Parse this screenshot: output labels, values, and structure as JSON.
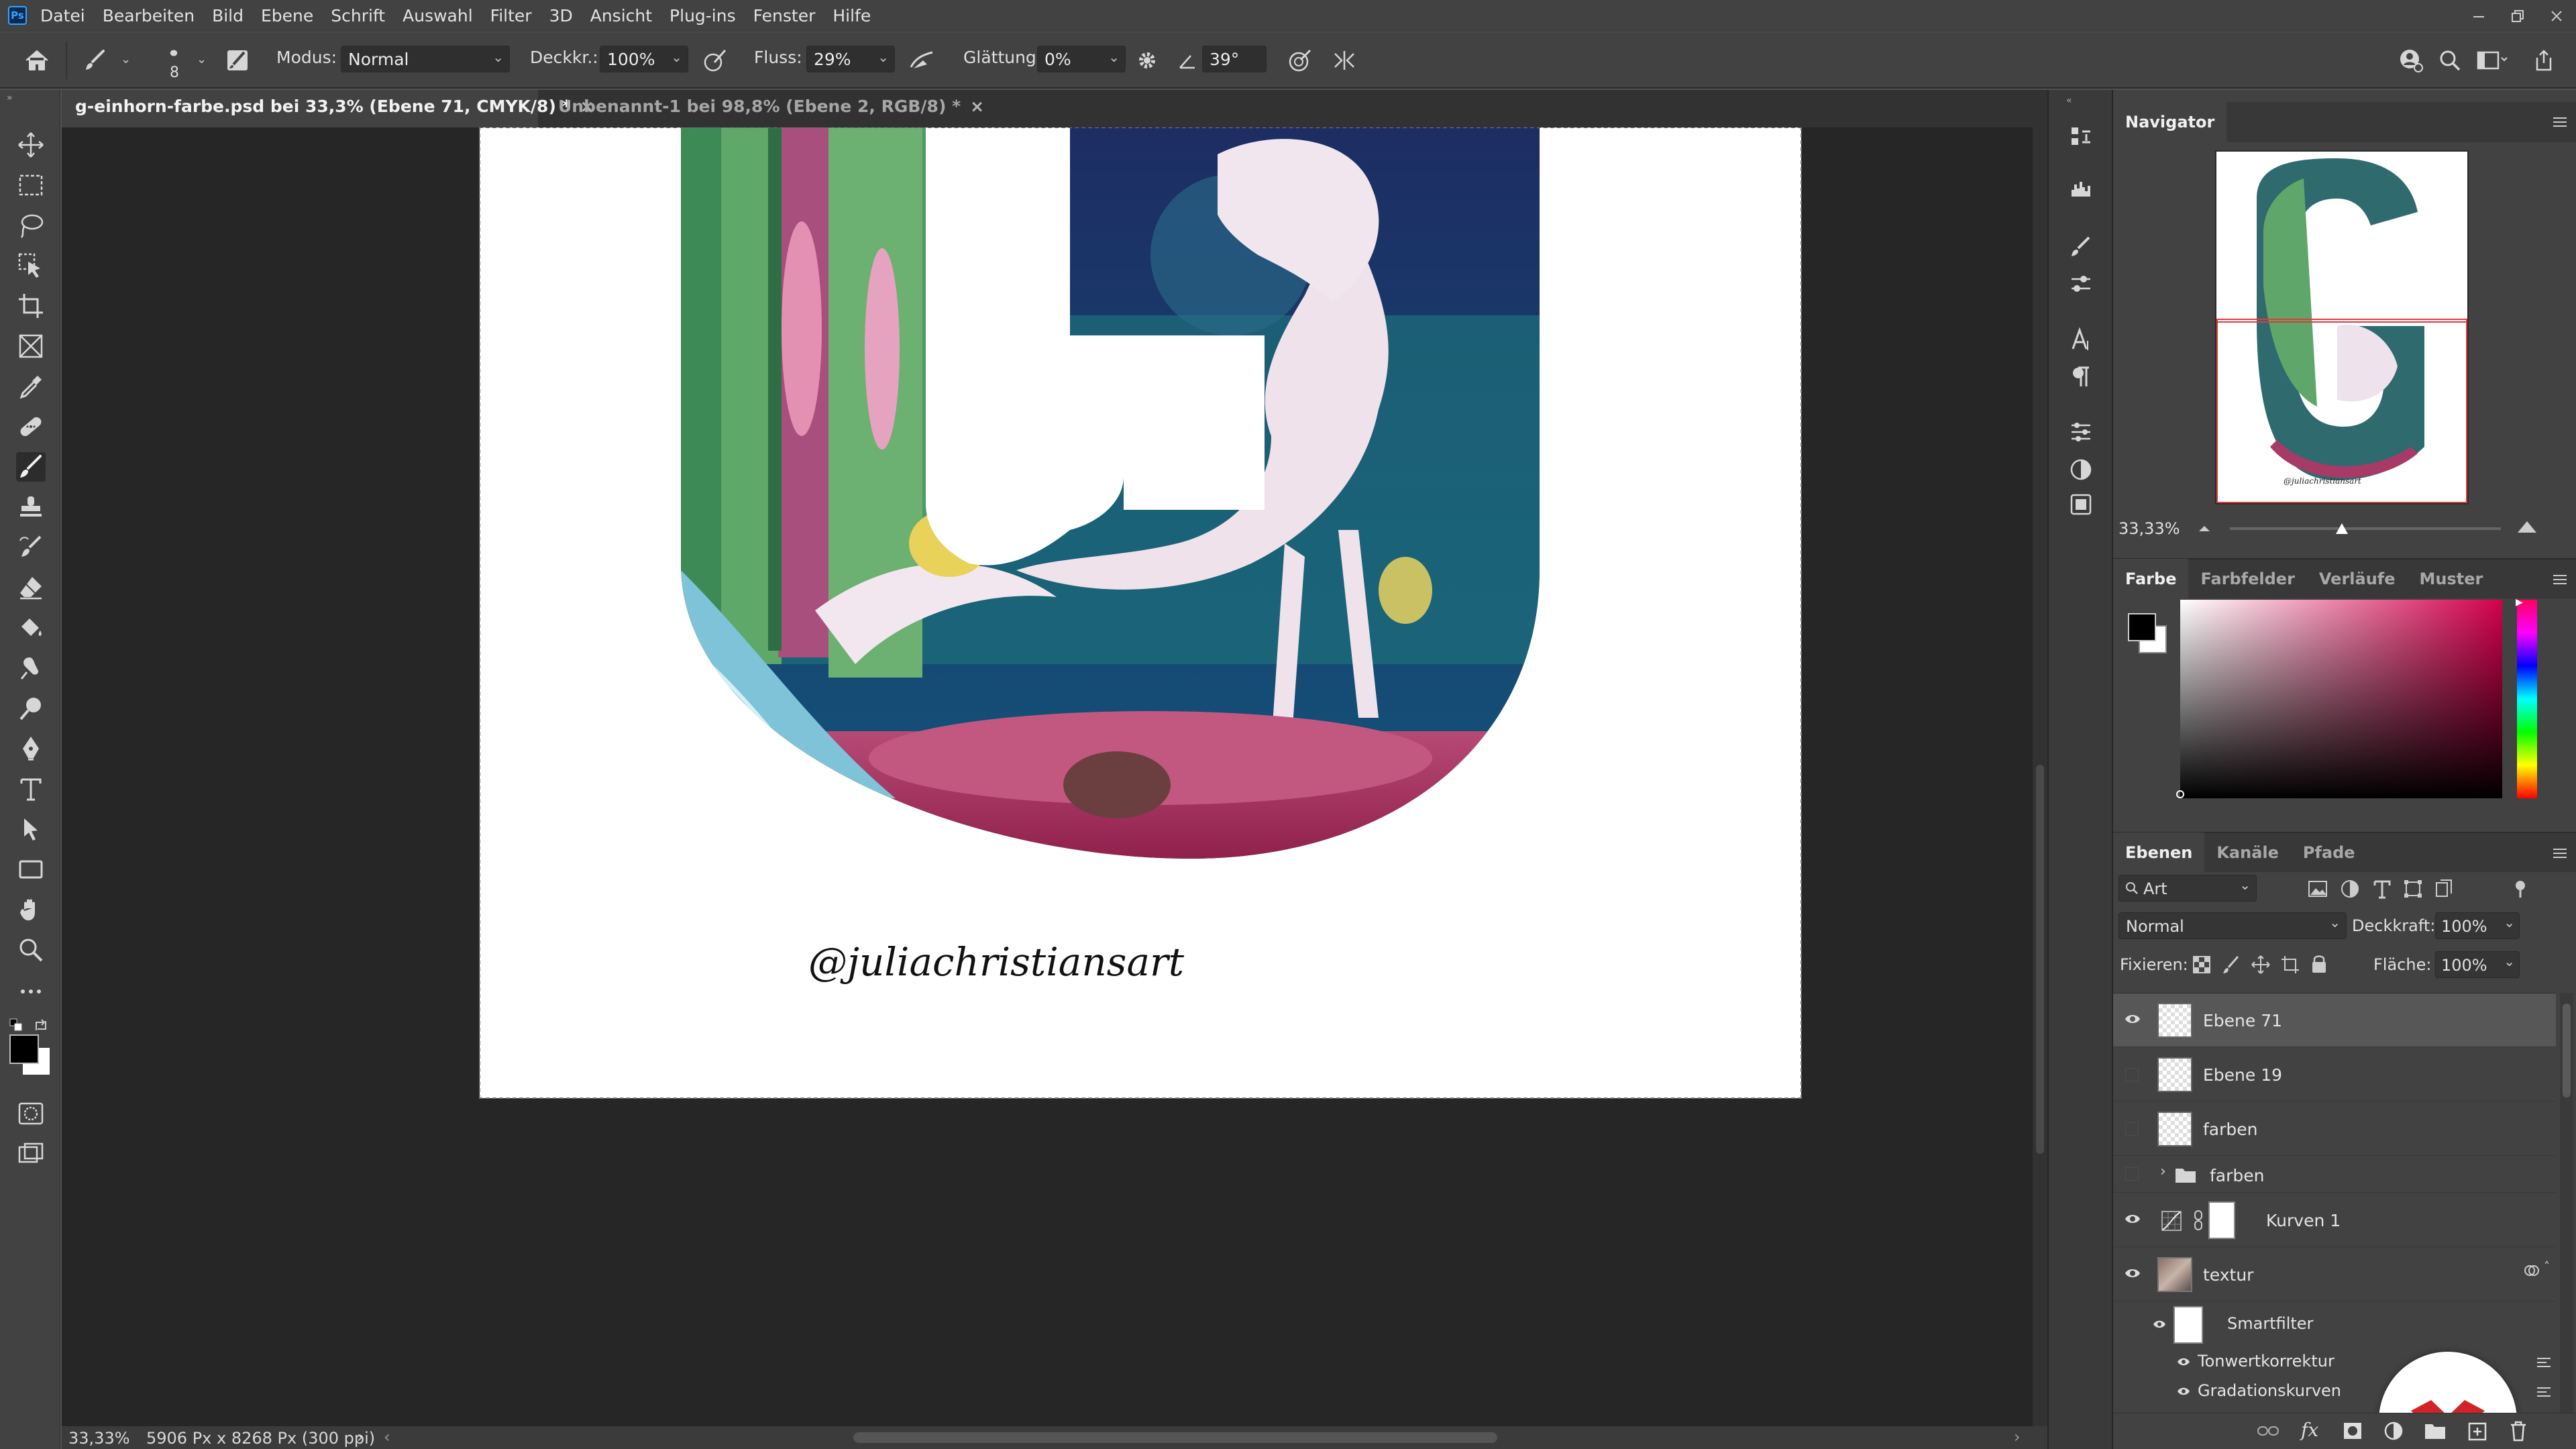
{
  "menubar": {
    "logo": "Ps",
    "items": [
      "Datei",
      "Bearbeiten",
      "Bild",
      "Ebene",
      "Schrift",
      "Auswahl",
      "Filter",
      "3D",
      "Ansicht",
      "Plug-ins",
      "Fenster",
      "Hilfe"
    ]
  },
  "options": {
    "brush_size": "8",
    "mode_label": "Modus:",
    "mode_value": "Normal",
    "opacity_label": "Deckkr.:",
    "opacity_value": "100%",
    "flow_label": "Fluss:",
    "flow_value": "29%",
    "smoothing_label": "Glättung:",
    "smoothing_value": "0%",
    "angle_value": "39°"
  },
  "tabs": [
    {
      "label": "g-einhorn-farbe.psd bei 33,3% (Ebene 71, CMYK/8) *",
      "active": true
    },
    {
      "label": "Unbenannt-1 bei 98,8% (Ebene 2, RGB/8) *",
      "active": false
    }
  ],
  "document": {
    "signature": "@juliachristiansart"
  },
  "status": {
    "zoom": "33,33%",
    "doc_info": "5906 Px x 8268 Px (300 ppi)",
    "arrow": "›"
  },
  "navigator": {
    "title": "Navigator",
    "zoom": "33,33%"
  },
  "color_panel": {
    "tabs": [
      "Farbe",
      "Farbfelder",
      "Verläufe",
      "Muster"
    ],
    "foreground": "#000000",
    "background": "#ffffff",
    "hue": "#d4004c"
  },
  "layers_panel": {
    "tabs": [
      "Ebenen",
      "Kanäle",
      "Pfade"
    ],
    "filter_kind": "Art",
    "blend_mode": "Normal",
    "opacity_label": "Deckkraft:",
    "opacity_value": "100%",
    "lock_label": "Fixieren:",
    "fill_label": "Fläche:",
    "fill_value": "100%",
    "layers": [
      {
        "name": "Ebene 71",
        "visible": true,
        "selected": true
      },
      {
        "name": "Ebene 19",
        "visible": false,
        "selected": false
      },
      {
        "name": "farben",
        "visible": false,
        "selected": false
      },
      {
        "name": "farben",
        "visible": false,
        "selected": false,
        "group": true
      },
      {
        "name": "Kurven 1",
        "visible": true,
        "selected": false
      },
      {
        "name": "textur",
        "visible": true,
        "selected": false
      }
    ],
    "smart_filter_label": "Smartfilter",
    "filters": [
      "Tonwertkorrektur",
      "Gradationskurven"
    ]
  },
  "colors": {
    "accent": "#d2232a",
    "selected_row": "#575757"
  }
}
